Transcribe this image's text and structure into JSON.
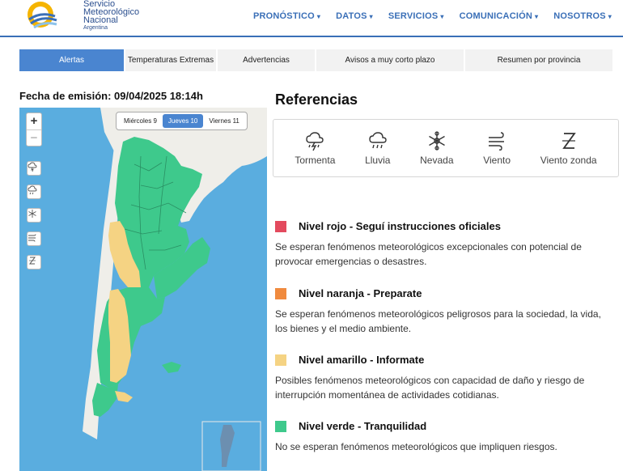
{
  "logo": {
    "line1": "Servicio",
    "line2": "Meteorológico",
    "line3": "Nacional",
    "line4": "Argentina"
  },
  "nav": {
    "items": [
      "PRONÓSTICO",
      "DATOS",
      "SERVICIOS",
      "COMUNICACIÓN",
      "NOSOTROS"
    ],
    "caret": "▾"
  },
  "tabs": [
    "Alertas",
    "Temperaturas Extremas",
    "Advertencias",
    "Avisos a muy corto plazo",
    "Resumen por provincia"
  ],
  "emission": "Fecha de emisión: 09/04/2025 18:14h",
  "map": {
    "zoom_in": "+",
    "zoom_out": "−",
    "days": [
      "Miércoles 9",
      "Jueves 10",
      "Viernes 11"
    ],
    "active_day": "Jueves 10",
    "side_buttons": [
      "storm-icon",
      "rain-icon",
      "snow-icon",
      "wind-icon",
      "zonda-icon"
    ],
    "colors": {
      "ocean": "#5aaddf",
      "land": "#efeee9",
      "green": "#3ec98c",
      "yellow": "#f5d383",
      "border": "#2a8f63"
    }
  },
  "references": {
    "title": "Referencias",
    "items": [
      {
        "icon": "storm-icon",
        "label": "Tormenta"
      },
      {
        "icon": "rain-icon",
        "label": "Lluvia"
      },
      {
        "icon": "snow-icon",
        "label": "Nevada"
      },
      {
        "icon": "wind-icon",
        "label": "Viento"
      },
      {
        "icon": "zonda-icon",
        "label": "Viento zonda"
      }
    ]
  },
  "levels": [
    {
      "color": "#e34a5e",
      "title": "Nivel rojo - Seguí instrucciones oficiales",
      "desc": "Se esperan fenómenos meteorológicos excepcionales con potencial de provocar emergencias o desastres."
    },
    {
      "color": "#f08a3e",
      "title": "Nivel naranja - Preparate",
      "desc": "Se esperan fenómenos meteorológicos peligrosos para la sociedad, la vida, los bienes y el medio ambiente."
    },
    {
      "color": "#f5d383",
      "title": "Nivel amarillo - Informate",
      "desc": "Posibles fenómenos meteorológicos con capacidad de daño y riesgo de interrupción momentánea de actividades cotidianas."
    },
    {
      "color": "#3ec98c",
      "title": "Nivel verde - Tranquilidad",
      "desc": "No se esperan fenómenos meteorológicos que impliquen riesgos."
    }
  ]
}
